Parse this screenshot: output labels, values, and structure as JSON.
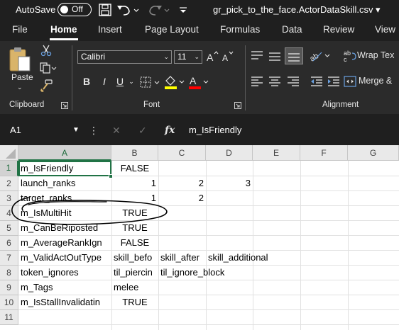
{
  "titlebar": {
    "autosave_label": "AutoSave",
    "autosave_state": "Off",
    "filename": "gr_pick_to_the_face.ActorDataSkill.csv ▾"
  },
  "tabs": [
    "File",
    "Home",
    "Insert",
    "Page Layout",
    "Formulas",
    "Data",
    "Review",
    "View"
  ],
  "active_tab": "Home",
  "ribbon": {
    "clipboard": {
      "paste_label": "Paste",
      "group_label": "Clipboard"
    },
    "font": {
      "font_name": "Calibri",
      "font_size": "11",
      "bold": "B",
      "italic": "I",
      "underline": "U",
      "group_label": "Font",
      "fill_color": "#ffff00",
      "font_color": "#ff0000"
    },
    "alignment": {
      "wrap_text": "Wrap Tex",
      "merge": "Merge &",
      "group_label": "Alignment"
    }
  },
  "formula_bar": {
    "name_box": "A1",
    "fx": "fx",
    "content": "m_IsFriendly"
  },
  "grid": {
    "columns": [
      "A",
      "B",
      "C",
      "D",
      "E",
      "F",
      "G"
    ],
    "selected_column": "A",
    "selected_cell": "A1",
    "rows": [
      {
        "num": "1",
        "a": "m_IsFriendly",
        "b": "FALSE",
        "c": "",
        "d": "",
        "e": ""
      },
      {
        "num": "2",
        "a": "launch_ranks",
        "b": "1",
        "c": "2",
        "d": "3",
        "e": ""
      },
      {
        "num": "3",
        "a": "target_ranks",
        "b": "1",
        "c": "2",
        "d": "",
        "e": ""
      },
      {
        "num": "4",
        "a": "m_IsMultiHit",
        "b": "TRUE",
        "c": "",
        "d": "",
        "e": ""
      },
      {
        "num": "5",
        "a": "m_CanBeRiposted",
        "b": "TRUE",
        "c": "",
        "d": "",
        "e": ""
      },
      {
        "num": "6",
        "a": "m_AverageRankIgn",
        "b": "FALSE",
        "c": "",
        "d": "",
        "e": ""
      },
      {
        "num": "7",
        "a": "m_ValidActOutType",
        "b": "skill_befo",
        "c": "skill_after",
        "d": "skill_additional",
        "e": ""
      },
      {
        "num": "8",
        "a": "token_ignores",
        "b": "til_piercin",
        "c": "til_ignore_block",
        "d": "",
        "e": ""
      },
      {
        "num": "9",
        "a": "m_Tags",
        "b": "melee",
        "c": "",
        "d": "",
        "e": ""
      },
      {
        "num": "10",
        "a": "m_IsStallInvalidatin",
        "b": "TRUE",
        "c": "",
        "d": "",
        "e": ""
      },
      {
        "num": "11",
        "a": "",
        "b": "",
        "c": "",
        "d": "",
        "e": ""
      }
    ],
    "accent_color": "#217346",
    "annotation_color": "#000000"
  }
}
